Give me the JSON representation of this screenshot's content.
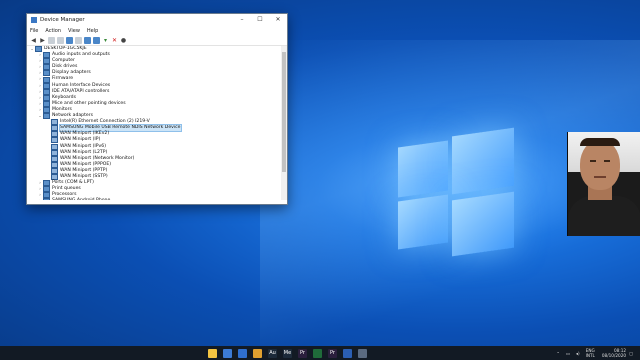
{
  "window": {
    "title": "Device Manager",
    "controls": {
      "minimize": "–",
      "maximize": "☐",
      "close": "✕"
    }
  },
  "menu": [
    "File",
    "Action",
    "View",
    "Help"
  ],
  "tree": [
    {
      "label": "DESKTOP-1GC5KJE",
      "level": 0,
      "expanded": true,
      "icon": "computer-icon"
    },
    {
      "label": "Audio inputs and outputs",
      "level": 1,
      "expanded": false,
      "icon": "audio-icon"
    },
    {
      "label": "Computer",
      "level": 1,
      "expanded": false,
      "icon": "computer-icon"
    },
    {
      "label": "Disk drives",
      "level": 1,
      "expanded": false,
      "icon": "disk-icon"
    },
    {
      "label": "Display adapters",
      "level": 1,
      "expanded": false,
      "icon": "display-icon"
    },
    {
      "label": "Firmware",
      "level": 1,
      "expanded": false,
      "icon": "firmware-icon"
    },
    {
      "label": "Human Interface Devices",
      "level": 1,
      "expanded": false,
      "icon": "hid-icon"
    },
    {
      "label": "IDE ATA/ATAPI controllers",
      "level": 1,
      "expanded": false,
      "icon": "ide-icon"
    },
    {
      "label": "Keyboards",
      "level": 1,
      "expanded": false,
      "icon": "keyboard-icon"
    },
    {
      "label": "Mice and other pointing devices",
      "level": 1,
      "expanded": false,
      "icon": "mouse-icon"
    },
    {
      "label": "Monitors",
      "level": 1,
      "expanded": false,
      "icon": "monitor-icon"
    },
    {
      "label": "Network adapters",
      "level": 1,
      "expanded": true,
      "icon": "network-icon"
    },
    {
      "label": "Intel(R) Ethernet Connection (2) I219-V",
      "level": 2,
      "icon": "network-adapter-icon"
    },
    {
      "label": "SAMSUNG Mobile USB Remote NDIS Network Device",
      "level": 2,
      "icon": "network-adapter-icon",
      "selected": true
    },
    {
      "label": "WAN Miniport (IKEv2)",
      "level": 2,
      "icon": "network-adapter-icon"
    },
    {
      "label": "WAN Miniport (IP)",
      "level": 2,
      "icon": "network-adapter-icon"
    },
    {
      "label": "WAN Miniport (IPv6)",
      "level": 2,
      "icon": "network-adapter-icon"
    },
    {
      "label": "WAN Miniport (L2TP)",
      "level": 2,
      "icon": "network-adapter-icon"
    },
    {
      "label": "WAN Miniport (Network Monitor)",
      "level": 2,
      "icon": "network-adapter-icon"
    },
    {
      "label": "WAN Miniport (PPPOE)",
      "level": 2,
      "icon": "network-adapter-icon"
    },
    {
      "label": "WAN Miniport (PPTP)",
      "level": 2,
      "icon": "network-adapter-icon"
    },
    {
      "label": "WAN Miniport (SSTP)",
      "level": 2,
      "icon": "network-adapter-icon"
    },
    {
      "label": "Ports (COM & LPT)",
      "level": 1,
      "expanded": false,
      "icon": "port-icon"
    },
    {
      "label": "Print queues",
      "level": 1,
      "expanded": false,
      "icon": "printer-icon"
    },
    {
      "label": "Processors",
      "level": 1,
      "expanded": false,
      "icon": "processor-icon"
    },
    {
      "label": "SAMSUNG Android Phone",
      "level": 1,
      "expanded": false,
      "icon": "phone-icon"
    }
  ],
  "taskbar": {
    "apps": [
      {
        "name": "file-explorer-icon",
        "color": "#f4c542",
        "glyph": ""
      },
      {
        "name": "store-icon",
        "color": "#3c7bd6",
        "glyph": ""
      },
      {
        "name": "mail-icon",
        "color": "#2f6fd0",
        "glyph": ""
      },
      {
        "name": "chrome-icon",
        "color": "#e0a030",
        "glyph": ""
      },
      {
        "name": "audition-icon",
        "color": "#1c2a3a",
        "glyph": "Au"
      },
      {
        "name": "media-encoder-icon",
        "color": "#1c2a3a",
        "glyph": "Me"
      },
      {
        "name": "premiere-icon",
        "color": "#2a1f3d",
        "glyph": "Pr"
      },
      {
        "name": "photo-icon",
        "color": "#1f6b3a",
        "glyph": ""
      },
      {
        "name": "premiere-pro-icon",
        "color": "#2a1f3d",
        "glyph": "Pr"
      },
      {
        "name": "word-icon",
        "color": "#2b5fb3",
        "glyph": ""
      },
      {
        "name": "device-manager-icon",
        "color": "#5a6a80",
        "glyph": ""
      }
    ],
    "tray": {
      "language": "ENG",
      "region": "INTL",
      "time": "08:12",
      "date": "08/10/2020"
    }
  }
}
